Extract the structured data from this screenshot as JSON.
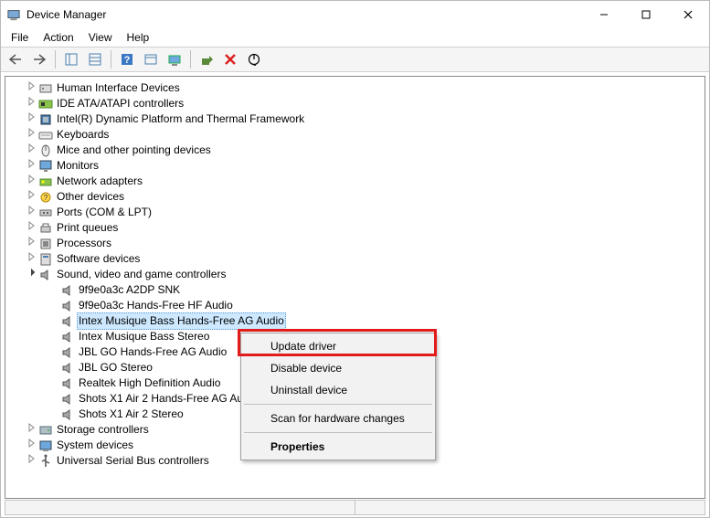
{
  "window": {
    "title": "Device Manager"
  },
  "menu": {
    "file": "File",
    "action": "Action",
    "view": "View",
    "help": "Help"
  },
  "tree": {
    "categories": [
      {
        "label": "Human Interface Devices",
        "icon": "hid"
      },
      {
        "label": "IDE ATA/ATAPI controllers",
        "icon": "ide"
      },
      {
        "label": "Intel(R) Dynamic Platform and Thermal Framework",
        "icon": "chip"
      },
      {
        "label": "Keyboards",
        "icon": "keyboard"
      },
      {
        "label": "Mice and other pointing devices",
        "icon": "mouse"
      },
      {
        "label": "Monitors",
        "icon": "monitor"
      },
      {
        "label": "Network adapters",
        "icon": "network"
      },
      {
        "label": "Other devices",
        "icon": "other"
      },
      {
        "label": "Ports (COM & LPT)",
        "icon": "port"
      },
      {
        "label": "Print queues",
        "icon": "printer"
      },
      {
        "label": "Processors",
        "icon": "cpu"
      },
      {
        "label": "Software devices",
        "icon": "software"
      }
    ],
    "sound": {
      "label": "Sound, video and game controllers",
      "devices": [
        "9f9e0a3c A2DP SNK",
        "9f9e0a3c Hands-Free HF Audio",
        "Intex Musique Bass Hands-Free AG Audio",
        "Intex Musique Bass Stereo",
        "JBL GO Hands-Free AG Audio",
        "JBL GO Stereo",
        "Realtek High Definition Audio",
        "Shots X1 Air 2 Hands-Free AG Audio",
        "Shots X1 Air 2 Stereo"
      ],
      "selected_index": 2
    },
    "after_sound": [
      {
        "label": "Storage controllers",
        "icon": "storage"
      },
      {
        "label": "System devices",
        "icon": "system"
      },
      {
        "label": "Universal Serial Bus controllers",
        "icon": "usb"
      }
    ]
  },
  "context_menu": {
    "update": "Update driver",
    "disable": "Disable device",
    "uninstall": "Uninstall device",
    "scan": "Scan for hardware changes",
    "properties": "Properties"
  }
}
